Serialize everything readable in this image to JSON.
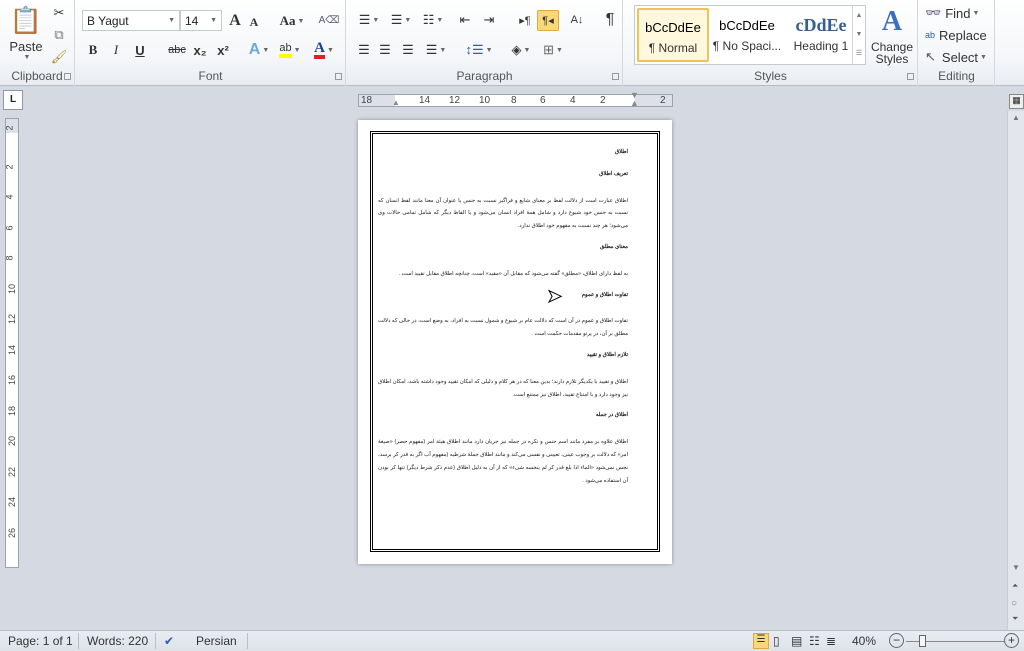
{
  "ribbon": {
    "clipboard": {
      "label": "Clipboard",
      "paste": "Paste"
    },
    "font": {
      "label": "Font",
      "name": "B Yagut",
      "size": "14",
      "bold": "B",
      "italic": "I",
      "underline": "U",
      "strike": "abc",
      "sub": "x₂",
      "sup": "x²",
      "grow": "A",
      "shrink": "A",
      "case": "Aa",
      "highlight_color": "#ffff00",
      "font_color": "#e02020"
    },
    "paragraph": {
      "label": "Paragraph"
    },
    "styles": {
      "label": "Styles",
      "items": [
        {
          "preview": "bCcDdEe",
          "name": "¶ Normal",
          "selected": true
        },
        {
          "preview": "bCcDdEe",
          "name": "¶ No Spaci..."
        },
        {
          "preview": "cDdEe",
          "name": "Heading 1"
        }
      ],
      "change": "Change Styles"
    },
    "editing": {
      "label": "Editing",
      "find": "Find",
      "replace": "Replace",
      "select": "Select"
    }
  },
  "ruler": {
    "labels": [
      "18",
      "14",
      "12",
      "10",
      "8",
      "6",
      "4",
      "2",
      "2"
    ]
  },
  "vruler": {
    "labels": [
      "2",
      "2",
      "4",
      "6",
      "8",
      "10",
      "12",
      "14",
      "16",
      "18",
      "20",
      "22",
      "24",
      "26"
    ]
  },
  "document": {
    "blocks": [
      {
        "type": "h",
        "text": "اطلاق"
      },
      {
        "type": "h",
        "text": "تعریف اطلاق"
      },
      {
        "type": "p",
        "text": "اطلاق عبارت است از دلالت لفظ بر معنای شایع و فراگیر نسبت به جنس یا عنوان آن معنا مانند لفظ انسان که نسبت به جنس خود شیوع دارد و شامل همهٔ افراد انسان می‌شود و یا الفاظ دیگر که شامل تمامی حالات وی می‌شود؛ هر چند نسبت به مفهوم خود اطلاق ندارد."
      },
      {
        "type": "h",
        "text": "معنای مطلق"
      },
      {
        "type": "p",
        "text": "به لفظ دارای اطلاق، «مطلق» گفته می‌شود که مقابل آن «مقید» است، چنانچه اطلاق مقابل تقیید است ."
      },
      {
        "type": "h",
        "text": "تفاوت اطلاق و عموم"
      },
      {
        "type": "p",
        "text": "تفاوت اطلاق و عموم در آن است که دلالت عام بر شیوع و شمول نسبت به افراد، به وضع است، در حالی که دلالت مطلق بر آن، در پرتو مقدمات حکمت است ."
      },
      {
        "type": "h",
        "text": "تلازم اطلاق و تقیید"
      },
      {
        "type": "p",
        "text": "اطلاق و تقیید با یکدیگر تلازم دارند؛ بدین معنا که در هر کلام و دلیلی که امکان تقیید وجود داشته باشد، امکان اطلاق نیز وجود دارد و با امتناع تقیید، اطلاق نیز ممتنع است."
      },
      {
        "type": "h",
        "text": "اطلاق در جمله"
      },
      {
        "type": "p",
        "text": "اطلاق علاوه بر مفرد مانند اسم جنس و نکره در جمله نیز جریان دارد مانند اطلاق هیئة امر (مفهوم حصر) «صیغهٔ امر» که دلالت بر وجوب عینی، تعیینی و نفسی می‌کند و مانند اطلاق جملهٔ شرطیه (مفهوم آب اگر به قدر کر برسد، نجس نمی‌شود «الماء اذا بلغ قدر کر لم ینجسه شیء» که از آن به دلیل اطلاق (عدم ذکر شرط دیگر) تنها کر بودن آن استفاده می‌شود ."
      }
    ]
  },
  "status": {
    "page": "Page: 1 of 1",
    "words": "Words: 220",
    "language": "Persian",
    "zoom": "40%",
    "zoom_percent": 40
  }
}
